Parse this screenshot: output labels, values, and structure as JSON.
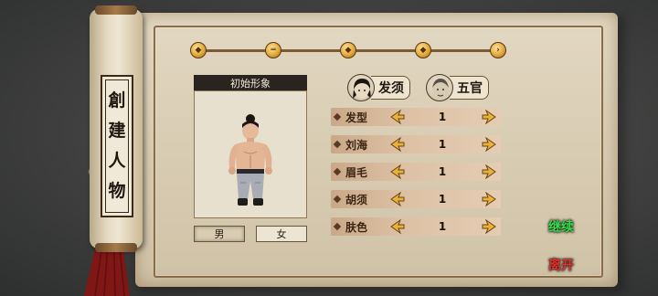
{
  "title": {
    "chars": [
      "創",
      "建",
      "人",
      "物"
    ]
  },
  "progress": {
    "current_step": 1,
    "total_steps": 5
  },
  "portrait": {
    "label": "初始形象"
  },
  "gender": {
    "male_label": "男",
    "female_label": "女",
    "selected": "男"
  },
  "tabs": [
    {
      "label": "发须",
      "icon": "hair-face-icon"
    },
    {
      "label": "五官",
      "icon": "face-features-icon"
    }
  ],
  "attributes": [
    {
      "label": "发型",
      "value": "1"
    },
    {
      "label": "刘海",
      "value": "1"
    },
    {
      "label": "眉毛",
      "value": "1"
    },
    {
      "label": "胡须",
      "value": "1"
    },
    {
      "label": "肤色",
      "value": "1"
    }
  ],
  "actions": {
    "continue_label": "继续",
    "leave_label": "离开"
  },
  "colors": {
    "parchment": "#d8ccb3",
    "row_bg": "#dcc0a4",
    "arrow_gold": "#e8b13a",
    "continue_green": "#39d94a",
    "leave_red": "#e0342a"
  }
}
